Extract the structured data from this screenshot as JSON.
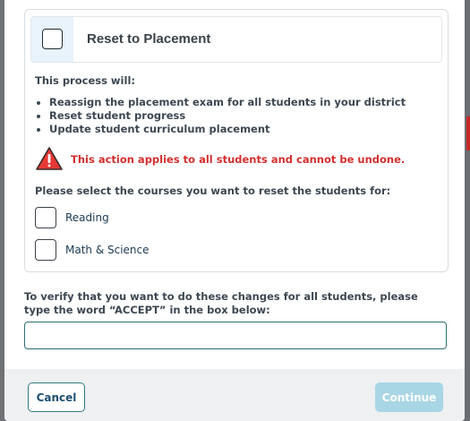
{
  "card": {
    "title": "Reset to Placement",
    "intro": "This process will:",
    "bullets": [
      "Reassign the placement exam for all students in your district",
      "Reset student progress",
      "Update student curriculum placement"
    ],
    "warning": "This action applies to all students and cannot be undone.",
    "select_label": "Please select the courses you want to reset the students for:",
    "courses": [
      {
        "label": "Reading",
        "checked": false
      },
      {
        "label": "Math & Science",
        "checked": false
      }
    ]
  },
  "verify": {
    "text": "To verify that you want to do these changes for all students, please type the word “ACCEPT” in the box below:",
    "value": "",
    "placeholder": ""
  },
  "footer": {
    "cancel_label": "Cancel",
    "continue_label": "Continue"
  },
  "colors": {
    "accent": "#2f7a80",
    "warning": "#d32f2f",
    "disabled_button": "#a9d6e5",
    "header_strip": "#e8f3fb"
  },
  "icons": {
    "warning": "warning-triangle-icon"
  }
}
